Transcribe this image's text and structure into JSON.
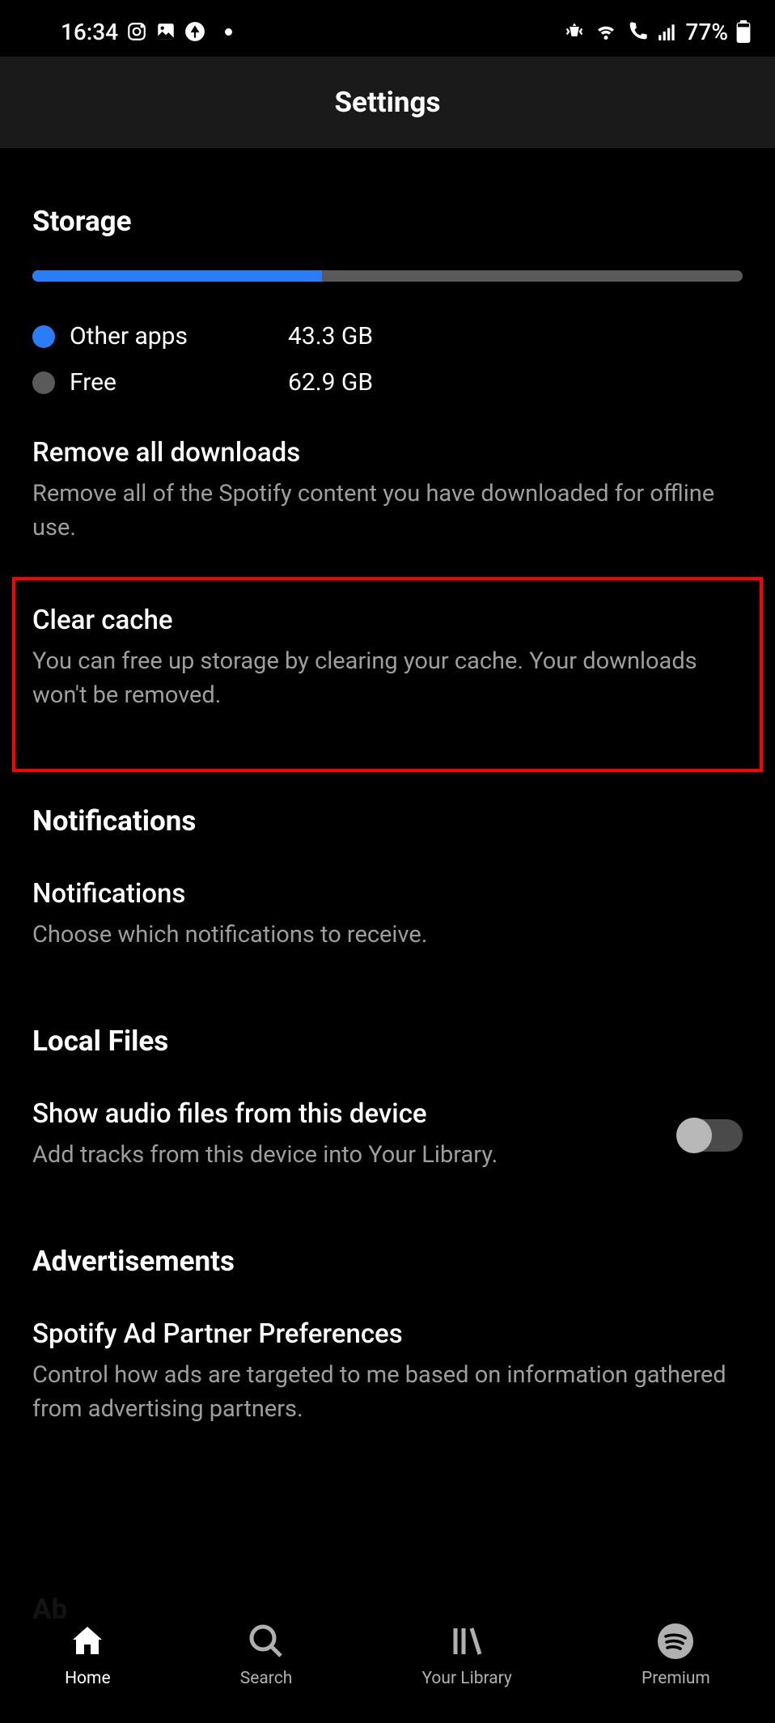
{
  "status": {
    "time": "16:34",
    "battery": "77%"
  },
  "header": {
    "title": "Settings"
  },
  "storage": {
    "section_title": "Storage",
    "legend": [
      {
        "label": "Other apps",
        "value": "43.3 GB",
        "color": "#2a7cf7"
      },
      {
        "label": "Free",
        "value": "62.9 GB",
        "color": "#5a5a5a"
      }
    ],
    "remove_downloads": {
      "title": "Remove all downloads",
      "desc": "Remove all of the Spotify content you have downloaded for offline use."
    },
    "clear_cache": {
      "title": "Clear cache",
      "desc": "You can free up storage by clearing your cache. Your downloads won't be removed."
    }
  },
  "notifications": {
    "section_title": "Notifications",
    "item": {
      "title": "Notifications",
      "desc": "Choose which notifications to receive."
    }
  },
  "local_files": {
    "section_title": "Local Files",
    "show_audio": {
      "title": "Show audio files from this device",
      "desc": "Add tracks from this device into Your Library."
    }
  },
  "advertisements": {
    "section_title": "Advertisements",
    "ad_prefs": {
      "title": "Spotify Ad Partner Preferences",
      "desc": "Control how ads are targeted to me based on information gathered from advertising partners."
    }
  },
  "about_peek": "Ab",
  "nav": {
    "home": "Home",
    "search": "Search",
    "library": "Your Library",
    "premium": "Premium"
  }
}
